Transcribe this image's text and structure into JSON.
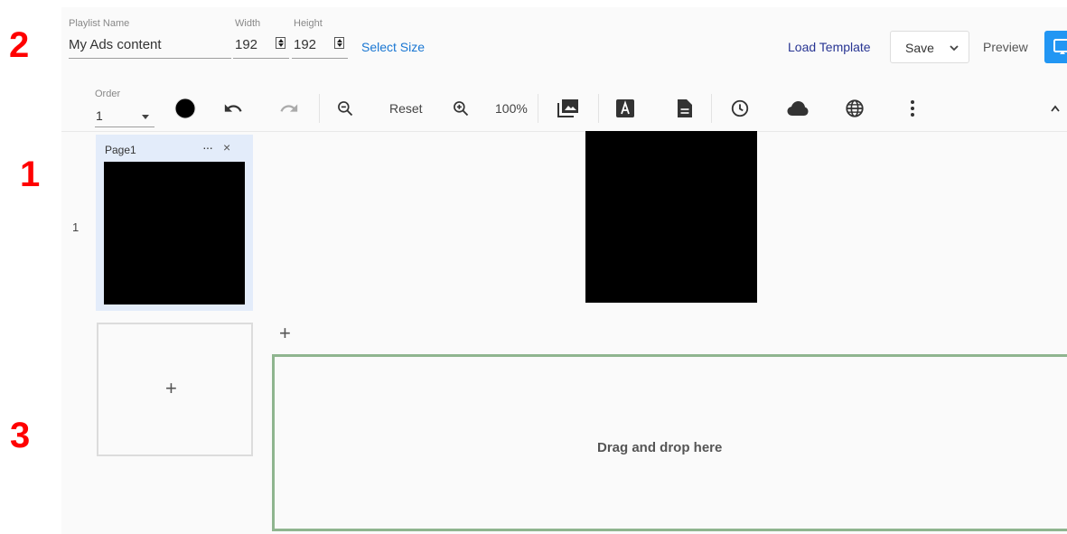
{
  "callouts": {
    "one": "1",
    "two": "2",
    "three": "3"
  },
  "header": {
    "playlist_name_label": "Playlist Name",
    "playlist_name_value": "My Ads content",
    "width_label": "Width",
    "width_value": "192",
    "height_label": "Height",
    "height_value": "192",
    "select_size": "Select Size",
    "load_template": "Load Template",
    "save_label": "Save",
    "preview_label": "Preview"
  },
  "toolbar": {
    "order_label": "Order",
    "order_value": "1",
    "reset_label": "Reset",
    "zoom_level": "100%",
    "color_swatch": "#000000",
    "icons": [
      "color-swatch-icon",
      "undo-icon",
      "redo-icon",
      "zoom-out-icon",
      "zoom-in-icon",
      "image-library-icon",
      "text-icon",
      "document-icon",
      "clock-icon",
      "cloud-icon",
      "globe-icon",
      "more-vert-icon",
      "collapse-icon"
    ]
  },
  "pages": [
    {
      "row_number": "1",
      "name": "Page1",
      "more_label": "···",
      "close_label": "×"
    }
  ],
  "add_page_plus": "+",
  "add_plus": "+",
  "dropzone": {
    "label": "Drag and drop here"
  },
  "colors": {
    "accent": "#2196f3",
    "link": "#1976d2",
    "dropzone_border": "#8fb58f",
    "page_card_bg": "#e3ecfa",
    "callout": "#ff0000"
  }
}
